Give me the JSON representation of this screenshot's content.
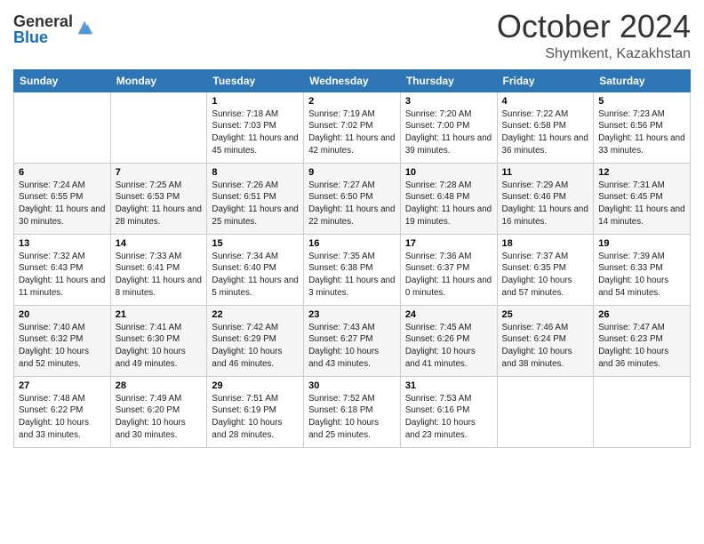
{
  "logo": {
    "general": "General",
    "blue": "Blue"
  },
  "header": {
    "month": "October 2024",
    "location": "Shymkent, Kazakhstan"
  },
  "weekdays": [
    "Sunday",
    "Monday",
    "Tuesday",
    "Wednesday",
    "Thursday",
    "Friday",
    "Saturday"
  ],
  "weeks": [
    [
      {
        "day": "",
        "info": ""
      },
      {
        "day": "",
        "info": ""
      },
      {
        "day": "1",
        "info": "Sunrise: 7:18 AM\nSunset: 7:03 PM\nDaylight: 11 hours and 45 minutes."
      },
      {
        "day": "2",
        "info": "Sunrise: 7:19 AM\nSunset: 7:02 PM\nDaylight: 11 hours and 42 minutes."
      },
      {
        "day": "3",
        "info": "Sunrise: 7:20 AM\nSunset: 7:00 PM\nDaylight: 11 hours and 39 minutes."
      },
      {
        "day": "4",
        "info": "Sunrise: 7:22 AM\nSunset: 6:58 PM\nDaylight: 11 hours and 36 minutes."
      },
      {
        "day": "5",
        "info": "Sunrise: 7:23 AM\nSunset: 6:56 PM\nDaylight: 11 hours and 33 minutes."
      }
    ],
    [
      {
        "day": "6",
        "info": "Sunrise: 7:24 AM\nSunset: 6:55 PM\nDaylight: 11 hours and 30 minutes."
      },
      {
        "day": "7",
        "info": "Sunrise: 7:25 AM\nSunset: 6:53 PM\nDaylight: 11 hours and 28 minutes."
      },
      {
        "day": "8",
        "info": "Sunrise: 7:26 AM\nSunset: 6:51 PM\nDaylight: 11 hours and 25 minutes."
      },
      {
        "day": "9",
        "info": "Sunrise: 7:27 AM\nSunset: 6:50 PM\nDaylight: 11 hours and 22 minutes."
      },
      {
        "day": "10",
        "info": "Sunrise: 7:28 AM\nSunset: 6:48 PM\nDaylight: 11 hours and 19 minutes."
      },
      {
        "day": "11",
        "info": "Sunrise: 7:29 AM\nSunset: 6:46 PM\nDaylight: 11 hours and 16 minutes."
      },
      {
        "day": "12",
        "info": "Sunrise: 7:31 AM\nSunset: 6:45 PM\nDaylight: 11 hours and 14 minutes."
      }
    ],
    [
      {
        "day": "13",
        "info": "Sunrise: 7:32 AM\nSunset: 6:43 PM\nDaylight: 11 hours and 11 minutes."
      },
      {
        "day": "14",
        "info": "Sunrise: 7:33 AM\nSunset: 6:41 PM\nDaylight: 11 hours and 8 minutes."
      },
      {
        "day": "15",
        "info": "Sunrise: 7:34 AM\nSunset: 6:40 PM\nDaylight: 11 hours and 5 minutes."
      },
      {
        "day": "16",
        "info": "Sunrise: 7:35 AM\nSunset: 6:38 PM\nDaylight: 11 hours and 3 minutes."
      },
      {
        "day": "17",
        "info": "Sunrise: 7:36 AM\nSunset: 6:37 PM\nDaylight: 11 hours and 0 minutes."
      },
      {
        "day": "18",
        "info": "Sunrise: 7:37 AM\nSunset: 6:35 PM\nDaylight: 10 hours and 57 minutes."
      },
      {
        "day": "19",
        "info": "Sunrise: 7:39 AM\nSunset: 6:33 PM\nDaylight: 10 hours and 54 minutes."
      }
    ],
    [
      {
        "day": "20",
        "info": "Sunrise: 7:40 AM\nSunset: 6:32 PM\nDaylight: 10 hours and 52 minutes."
      },
      {
        "day": "21",
        "info": "Sunrise: 7:41 AM\nSunset: 6:30 PM\nDaylight: 10 hours and 49 minutes."
      },
      {
        "day": "22",
        "info": "Sunrise: 7:42 AM\nSunset: 6:29 PM\nDaylight: 10 hours and 46 minutes."
      },
      {
        "day": "23",
        "info": "Sunrise: 7:43 AM\nSunset: 6:27 PM\nDaylight: 10 hours and 43 minutes."
      },
      {
        "day": "24",
        "info": "Sunrise: 7:45 AM\nSunset: 6:26 PM\nDaylight: 10 hours and 41 minutes."
      },
      {
        "day": "25",
        "info": "Sunrise: 7:46 AM\nSunset: 6:24 PM\nDaylight: 10 hours and 38 minutes."
      },
      {
        "day": "26",
        "info": "Sunrise: 7:47 AM\nSunset: 6:23 PM\nDaylight: 10 hours and 36 minutes."
      }
    ],
    [
      {
        "day": "27",
        "info": "Sunrise: 7:48 AM\nSunset: 6:22 PM\nDaylight: 10 hours and 33 minutes."
      },
      {
        "day": "28",
        "info": "Sunrise: 7:49 AM\nSunset: 6:20 PM\nDaylight: 10 hours and 30 minutes."
      },
      {
        "day": "29",
        "info": "Sunrise: 7:51 AM\nSunset: 6:19 PM\nDaylight: 10 hours and 28 minutes."
      },
      {
        "day": "30",
        "info": "Sunrise: 7:52 AM\nSunset: 6:18 PM\nDaylight: 10 hours and 25 minutes."
      },
      {
        "day": "31",
        "info": "Sunrise: 7:53 AM\nSunset: 6:16 PM\nDaylight: 10 hours and 23 minutes."
      },
      {
        "day": "",
        "info": ""
      },
      {
        "day": "",
        "info": ""
      }
    ]
  ]
}
